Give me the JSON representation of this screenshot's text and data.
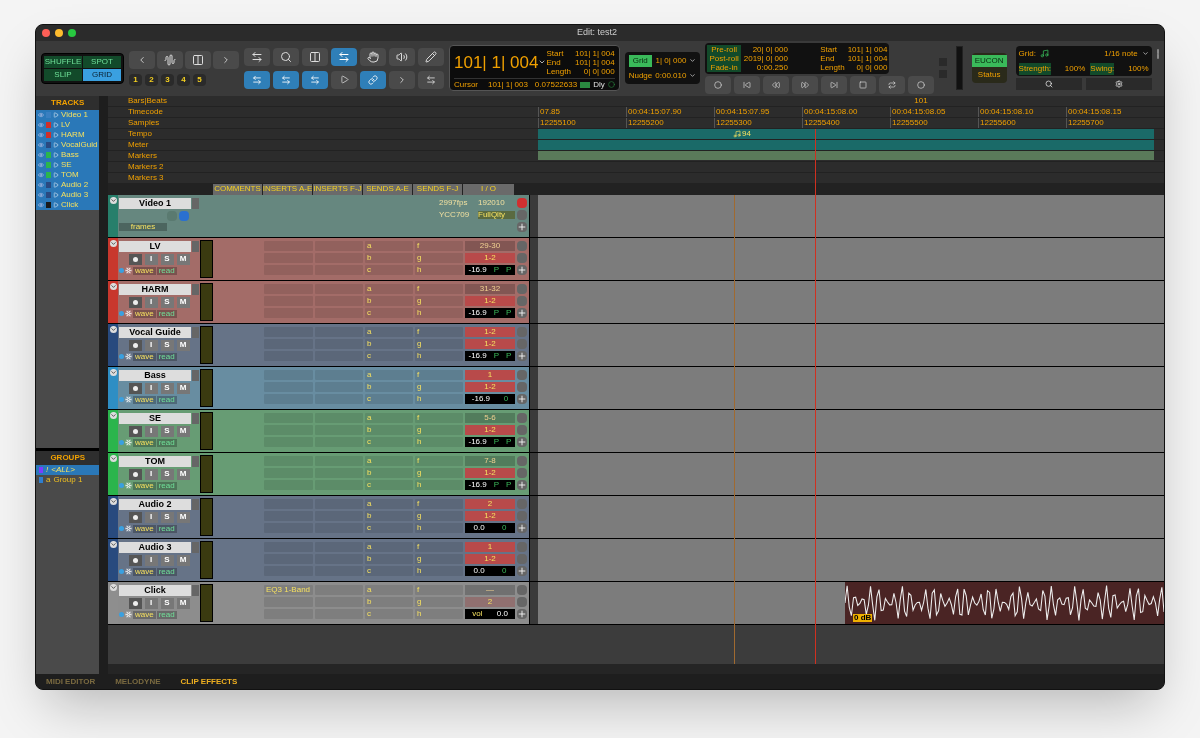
{
  "window": {
    "title": "Edit: test2"
  },
  "edit_modes": [
    {
      "label": "SHUFFLE",
      "selected": false
    },
    {
      "label": "SPOT",
      "selected": false
    },
    {
      "label": "SLIP",
      "selected": false
    },
    {
      "label": "GRID",
      "selected": true
    }
  ],
  "zoom_presets": [
    "1",
    "2",
    "3",
    "4",
    "5"
  ],
  "counter": {
    "value": "101| 1| 004",
    "start_label": "Start",
    "start": "101| 1| 004",
    "end_label": "End",
    "end": "101| 1| 004",
    "length_label": "Length",
    "length": "0| 0| 000",
    "cursor_label": "Cursor",
    "cursor": "101| 1| 003",
    "sample": "0.07522633",
    "dly": "Dly"
  },
  "grid": {
    "label": "Grid",
    "value": "1| 0| 000"
  },
  "nudge": {
    "label": "Nudge",
    "value": "0:00.010"
  },
  "transport": {
    "preroll_label": "Pre-roll",
    "preroll": "20| 0| 000",
    "postroll_label": "Post-roll",
    "postroll": "2019| 0| 000",
    "fadein_label": "Fade-in",
    "fadein": "0:00.250",
    "start_label": "Start",
    "start": "101| 1| 004",
    "end_label": "End",
    "end": "101| 1| 004",
    "length_label": "Length",
    "length": "0| 0| 000"
  },
  "eucon": {
    "label": "EUCON",
    "status": "Status"
  },
  "quantize": {
    "grid_label": "Grid:",
    "grid": "1/16 note",
    "strength_label": "Strength:",
    "strength": "100%",
    "swing_label": "Swing:",
    "swing": "100%"
  },
  "tracks_panel": {
    "title": "TRACKS",
    "items": [
      {
        "name": "Video 1",
        "color": "#3a7fc0",
        "selected": true
      },
      {
        "name": "LV",
        "color": "#d0302a",
        "selected": true
      },
      {
        "name": "HARM",
        "color": "#d0302a",
        "selected": true
      },
      {
        "name": "VocalGuid",
        "color": "#2a4a80",
        "selected": true
      },
      {
        "name": "Bass",
        "color": "#2bb54c",
        "selected": true
      },
      {
        "name": "SE",
        "color": "#2bb54c",
        "selected": true
      },
      {
        "name": "TOM",
        "color": "#2bb54c",
        "selected": true
      },
      {
        "name": "Audio 2",
        "color": "#2a4a80",
        "selected": true
      },
      {
        "name": "Audio 3",
        "color": "#2a4a80",
        "selected": true
      },
      {
        "name": "Click",
        "color": "#1a1a1a",
        "selected": true
      }
    ]
  },
  "groups_panel": {
    "title": "GROUPS",
    "items": [
      {
        "id": "!",
        "name": "<ALL>",
        "color": "#7a3cff",
        "selected": true
      },
      {
        "id": "a",
        "name": "Group 1",
        "color": "#2e7fd0",
        "selected": false
      }
    ]
  },
  "rulers": [
    {
      "label": "Bars|Beats",
      "kind": "bars",
      "ticks": [
        "101"
      ]
    },
    {
      "label": "Timecode",
      "kind": "timecode",
      "ticks": [
        "07.85",
        "00:04:15:07.90",
        "00:04:15:07.95",
        "00:04:15:08.00",
        "00:04:15:08.05",
        "00:04:15:08.10",
        "00:04:15:08.15"
      ]
    },
    {
      "label": "Samples",
      "kind": "samples",
      "ticks": [
        "12255100",
        "12255200",
        "12255300",
        "12255400",
        "12255500",
        "12255600",
        "12255700"
      ]
    },
    {
      "label": "Tempo",
      "kind": "tempo",
      "marker": "94"
    },
    {
      "label": "Meter",
      "kind": "meter"
    },
    {
      "label": "Markers",
      "kind": "markers",
      "range": true
    },
    {
      "label": "Markers 2",
      "kind": "markers",
      "range": false
    },
    {
      "label": "Markers 3",
      "kind": "markers",
      "range": false
    }
  ],
  "columns": [
    "COMMENTS",
    "INSERTS A-E",
    "INSERTS F-J",
    "SENDS A-E",
    "SENDS F-J",
    "I / O"
  ],
  "tracks": [
    {
      "kind": "video",
      "name": "Video 1",
      "color": "#277f6b",
      "units": "frames",
      "fps": "2997fps",
      "resolution": "192010",
      "codec": "YCC709",
      "quality": "FullQlty"
    },
    {
      "kind": "audio",
      "name": "LV",
      "color": "#c8372d",
      "buttons": [
        "I",
        "S",
        "M"
      ],
      "view": "wave",
      "automation": "read",
      "sends_ae": [
        "a",
        "b",
        "c"
      ],
      "sends_fj": [
        "f",
        "g",
        "h"
      ],
      "input": "29-30",
      "input_active": false,
      "output": "1-2",
      "output_active": true,
      "volume": "-16.9",
      "pan": [
        "P",
        "P"
      ]
    },
    {
      "kind": "audio",
      "name": "HARM",
      "color": "#c8372d",
      "buttons": [
        "I",
        "S",
        "M"
      ],
      "view": "wave",
      "automation": "read",
      "sends_ae": [
        "a",
        "b",
        "c"
      ],
      "sends_fj": [
        "f",
        "g",
        "h"
      ],
      "input": "31-32",
      "input_active": false,
      "output": "1-2",
      "output_active": true,
      "volume": "-16.9",
      "pan": [
        "P",
        "P"
      ]
    },
    {
      "kind": "audio",
      "name": "Vocal Guide",
      "color": "#284a7e",
      "buttons": [
        "I",
        "S",
        "M"
      ],
      "view": "wave",
      "automation": "read",
      "sends_ae": [
        "a",
        "b",
        "c"
      ],
      "sends_fj": [
        "f",
        "g",
        "h"
      ],
      "input": "1-2",
      "input_active": true,
      "output": "1-2",
      "output_active": true,
      "volume": "-16.9",
      "pan": [
        "P",
        "P"
      ]
    },
    {
      "kind": "audio",
      "name": "Bass",
      "color": "#2e8ec4",
      "buttons": [
        "I",
        "S",
        "M"
      ],
      "view": "wave",
      "automation": "read",
      "sends_ae": [
        "a",
        "b",
        "c"
      ],
      "sends_fj": [
        "f",
        "g",
        "h"
      ],
      "input": "1",
      "input_active": true,
      "output": "1-2",
      "output_active": true,
      "volume": "-16.9",
      "pan": [
        "0"
      ]
    },
    {
      "kind": "audio",
      "name": "SE",
      "color": "#2bb54c",
      "buttons": [
        "I",
        "S",
        "M"
      ],
      "view": "wave",
      "automation": "read",
      "sends_ae": [
        "a",
        "b",
        "c"
      ],
      "sends_fj": [
        "f",
        "g",
        "h"
      ],
      "input": "5-6",
      "input_active": false,
      "output": "1-2",
      "output_active": true,
      "volume": "-16.9",
      "pan": [
        "P",
        "P"
      ]
    },
    {
      "kind": "audio",
      "name": "TOM",
      "color": "#2bb54c",
      "buttons": [
        "I",
        "S",
        "M"
      ],
      "view": "wave",
      "automation": "read",
      "sends_ae": [
        "a",
        "b",
        "c"
      ],
      "sends_fj": [
        "f",
        "g",
        "h"
      ],
      "input": "7-8",
      "input_active": false,
      "output": "1-2",
      "output_active": true,
      "volume": "-16.9",
      "pan": [
        "P",
        "P"
      ]
    },
    {
      "kind": "audio",
      "name": "Audio 2",
      "color": "#284a7e",
      "buttons": [
        "I",
        "S",
        "M"
      ],
      "view": "wave",
      "automation": "read",
      "sends_ae": [
        "a",
        "b",
        "c"
      ],
      "sends_fj": [
        "f",
        "g",
        "h"
      ],
      "input": "2",
      "input_active": true,
      "output": "1-2",
      "output_active": true,
      "volume": "0.0",
      "pan": [
        "0"
      ]
    },
    {
      "kind": "audio",
      "name": "Audio 3",
      "color": "#284a7e",
      "buttons": [
        "I",
        "S",
        "M"
      ],
      "view": "wave",
      "automation": "read",
      "sends_ae": [
        "a",
        "b",
        "c"
      ],
      "sends_fj": [
        "f",
        "g",
        "h"
      ],
      "input": "1",
      "input_active": true,
      "output": "1-2",
      "output_active": true,
      "volume": "0.0",
      "pan": [
        "0"
      ]
    },
    {
      "kind": "audio",
      "name": "Click",
      "color": "#8e8e8e",
      "buttons": [
        "I",
        "S",
        "M"
      ],
      "view": "wave",
      "automation": "read",
      "insert": "EQ3 1-Band",
      "sends_ae": [
        "a",
        "b",
        "c"
      ],
      "sends_fj": [
        "f",
        "g",
        "h"
      ],
      "input": "—",
      "input_active": false,
      "output": "2",
      "output_active": false,
      "volume_label": "vol",
      "volume": "0.0",
      "clip": {
        "label": "0 dB"
      }
    }
  ],
  "bottom_tabs": [
    {
      "label": "MIDI EDITOR",
      "selected": false
    },
    {
      "label": "MELODYNE",
      "selected": false
    },
    {
      "label": "CLIP EFFECTS",
      "selected": true
    }
  ]
}
